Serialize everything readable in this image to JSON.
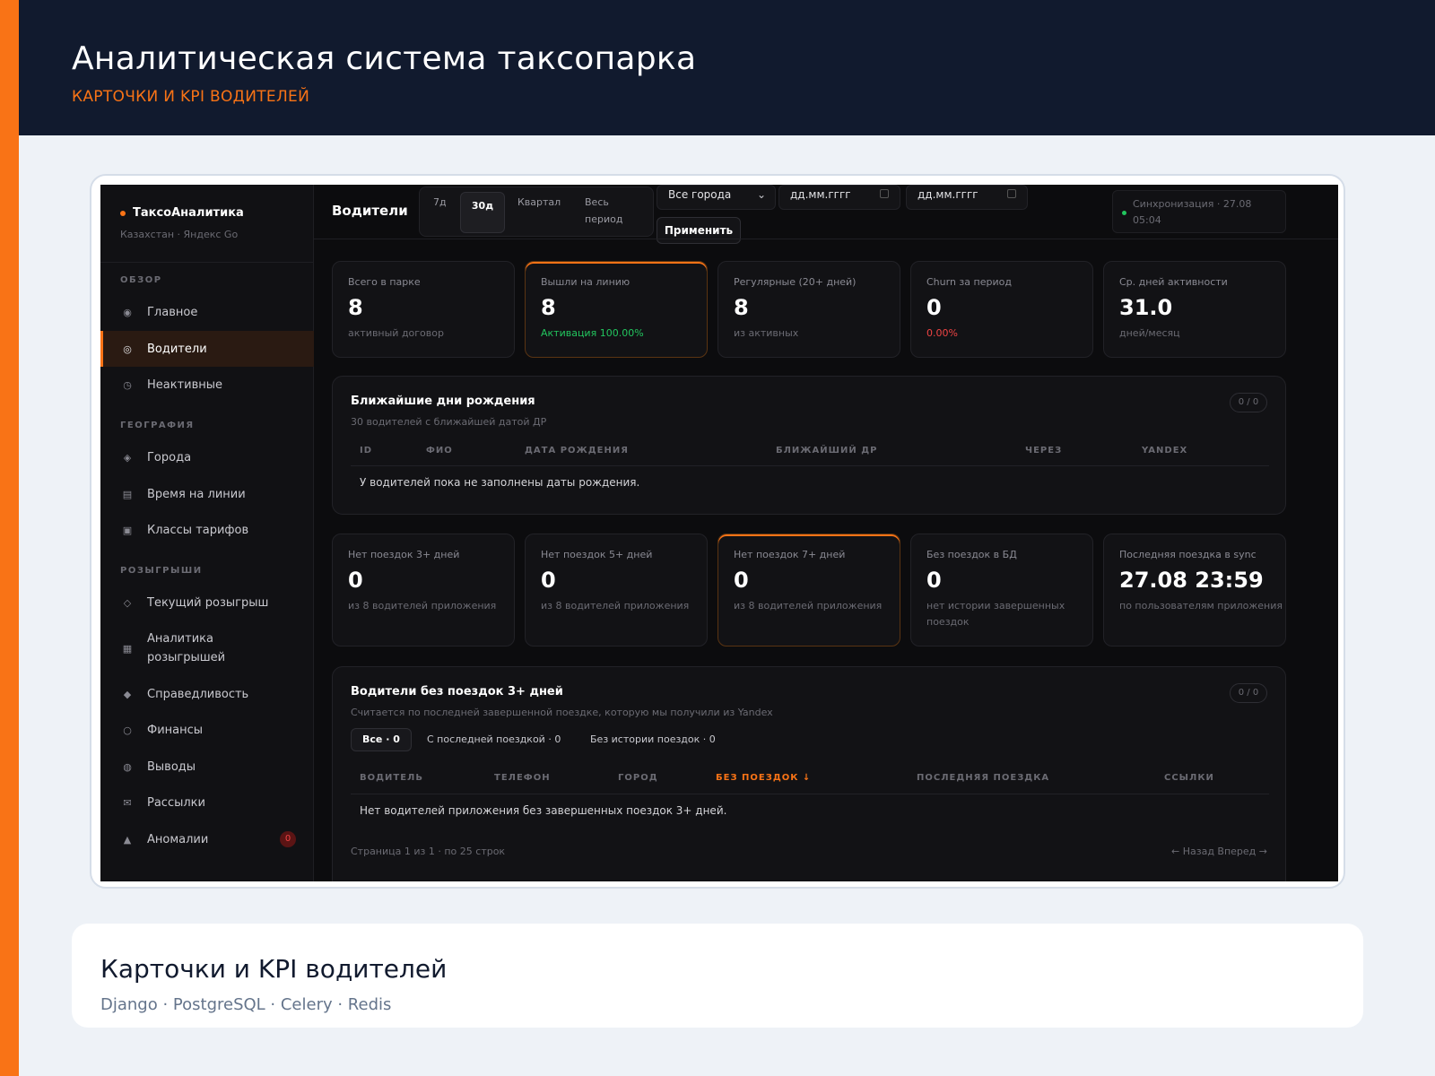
{
  "banner": {
    "title": "Аналитическая система таксопарка",
    "subtitle": "КАРТОЧКИ И KPI ВОДИТЕЛЕЙ"
  },
  "app": {
    "brand": "ТаксоАналитика",
    "brand_sub": "Казахстан · Яндекс Go",
    "accent": "#f97316",
    "sections": {
      "overview": "ОБЗОР",
      "geography": "ГЕОГРАФИЯ",
      "draws": "РОЗЫГРЫШИ"
    },
    "nav": {
      "home": {
        "label": "Главное",
        "icon": "dot-icon"
      },
      "drivers": {
        "label": "Водители",
        "icon": "target-icon"
      },
      "inactive": {
        "label": "Неактивные",
        "icon": "clock-icon"
      },
      "cities": {
        "label": "Города",
        "icon": "diamond-icon"
      },
      "online_time": {
        "label": "Время на линии",
        "icon": "list-icon"
      },
      "tariffs": {
        "label": "Классы тарифов",
        "icon": "square-icon"
      },
      "current_draw": {
        "label": "Текущий розыгрыш",
        "icon": "diamond-outline-icon"
      },
      "draw_analytics_1": "Аналитика",
      "draw_analytics_2": "розыгрышей",
      "fairness": {
        "label": "Справедливость",
        "icon": "diamond-filled-icon"
      },
      "finance": {
        "label": "Финансы",
        "icon": "circle-icon"
      },
      "withdrawals": {
        "label": "Выводы",
        "icon": "globe-icon"
      },
      "mailings": {
        "label": "Рассылки",
        "icon": "mail-icon"
      },
      "anomalies": {
        "label": "Аномалии",
        "icon": "warning-icon",
        "badge": "0"
      }
    }
  },
  "topbar": {
    "title": "Водители",
    "periods": [
      "7д",
      "30д",
      "Квартал",
      "Весь",
      "период"
    ],
    "city": "Все города",
    "date_from": "дд.мм.гггг",
    "date_to": "дд.мм.гггг",
    "apply": "Применить",
    "sync_1": "Синхронизация · 27.08",
    "sync_2": "05:04"
  },
  "kpis": [
    {
      "label": "Всего в парке",
      "value": "8",
      "sub": "активный договор"
    },
    {
      "label": "Вышли на линию",
      "value": "8",
      "sub": "Активация 100.00%"
    },
    {
      "label": "Регулярные (20+ дней)",
      "value": "8",
      "sub": "из активных"
    },
    {
      "label": "Churn за период",
      "value": "0",
      "sub": "0.00%"
    },
    {
      "label": "Ср. дней активности",
      "value": "31.0",
      "sub": "дней/месяц"
    }
  ],
  "birthdays": {
    "title": "Ближайшие дни рождения",
    "subtitle": "30 водителей с ближайшей датой ДР",
    "count": "0 / 0",
    "columns": [
      "ID",
      "ФИО",
      "ДАТА РОЖДЕНИЯ",
      "БЛИЖАЙШИЙ ДР",
      "ЧЕРЕЗ",
      "YANDEX"
    ],
    "empty": "У водителей пока не заполнены даты рождения."
  },
  "kpis2": [
    {
      "label": "Нет поездок 3+ дней",
      "value": "0",
      "sub": "из 8 водителей приложения"
    },
    {
      "label": "Нет поездок 5+ дней",
      "value": "0",
      "sub": "из 8 водителей приложения"
    },
    {
      "label": "Нет поездок 7+ дней",
      "value": "0",
      "sub": "из 8 водителей приложения"
    },
    {
      "label": "Без поездок в БД",
      "value": "0",
      "sub": "нет истории завершенных поездок"
    },
    {
      "label": "Последняя поездка в sync",
      "value": "27.08 23:59",
      "sub": "по пользователям приложения"
    }
  ],
  "no_trips": {
    "title": "Водители без поездок 3+ дней",
    "subtitle": "Считается по последней завершенной поездке, которую мы получили из Yandex",
    "count": "0 / 0",
    "filters": [
      "Все · 0",
      "С последней поездкой · 0",
      "Без истории поездок · 0"
    ],
    "columns": [
      "ВОДИТЕЛЬ",
      "ТЕЛЕФОН",
      "ГОРОД",
      "БЕЗ ПОЕЗДОК ↓",
      "ПОСЛЕДНЯЯ ПОЕЗДКА",
      "ССЫЛКИ"
    ],
    "empty": "Нет водителей приложения без завершенных поездок 3+ дней.",
    "pager_info": "Страница 1 из 1 · по 25 строк",
    "pager_nav": "← Назад  Вперед →"
  },
  "caption": {
    "title": "Карточки и KPI водителей",
    "stack": "Django · PostgreSQL · Celery · Redis"
  }
}
